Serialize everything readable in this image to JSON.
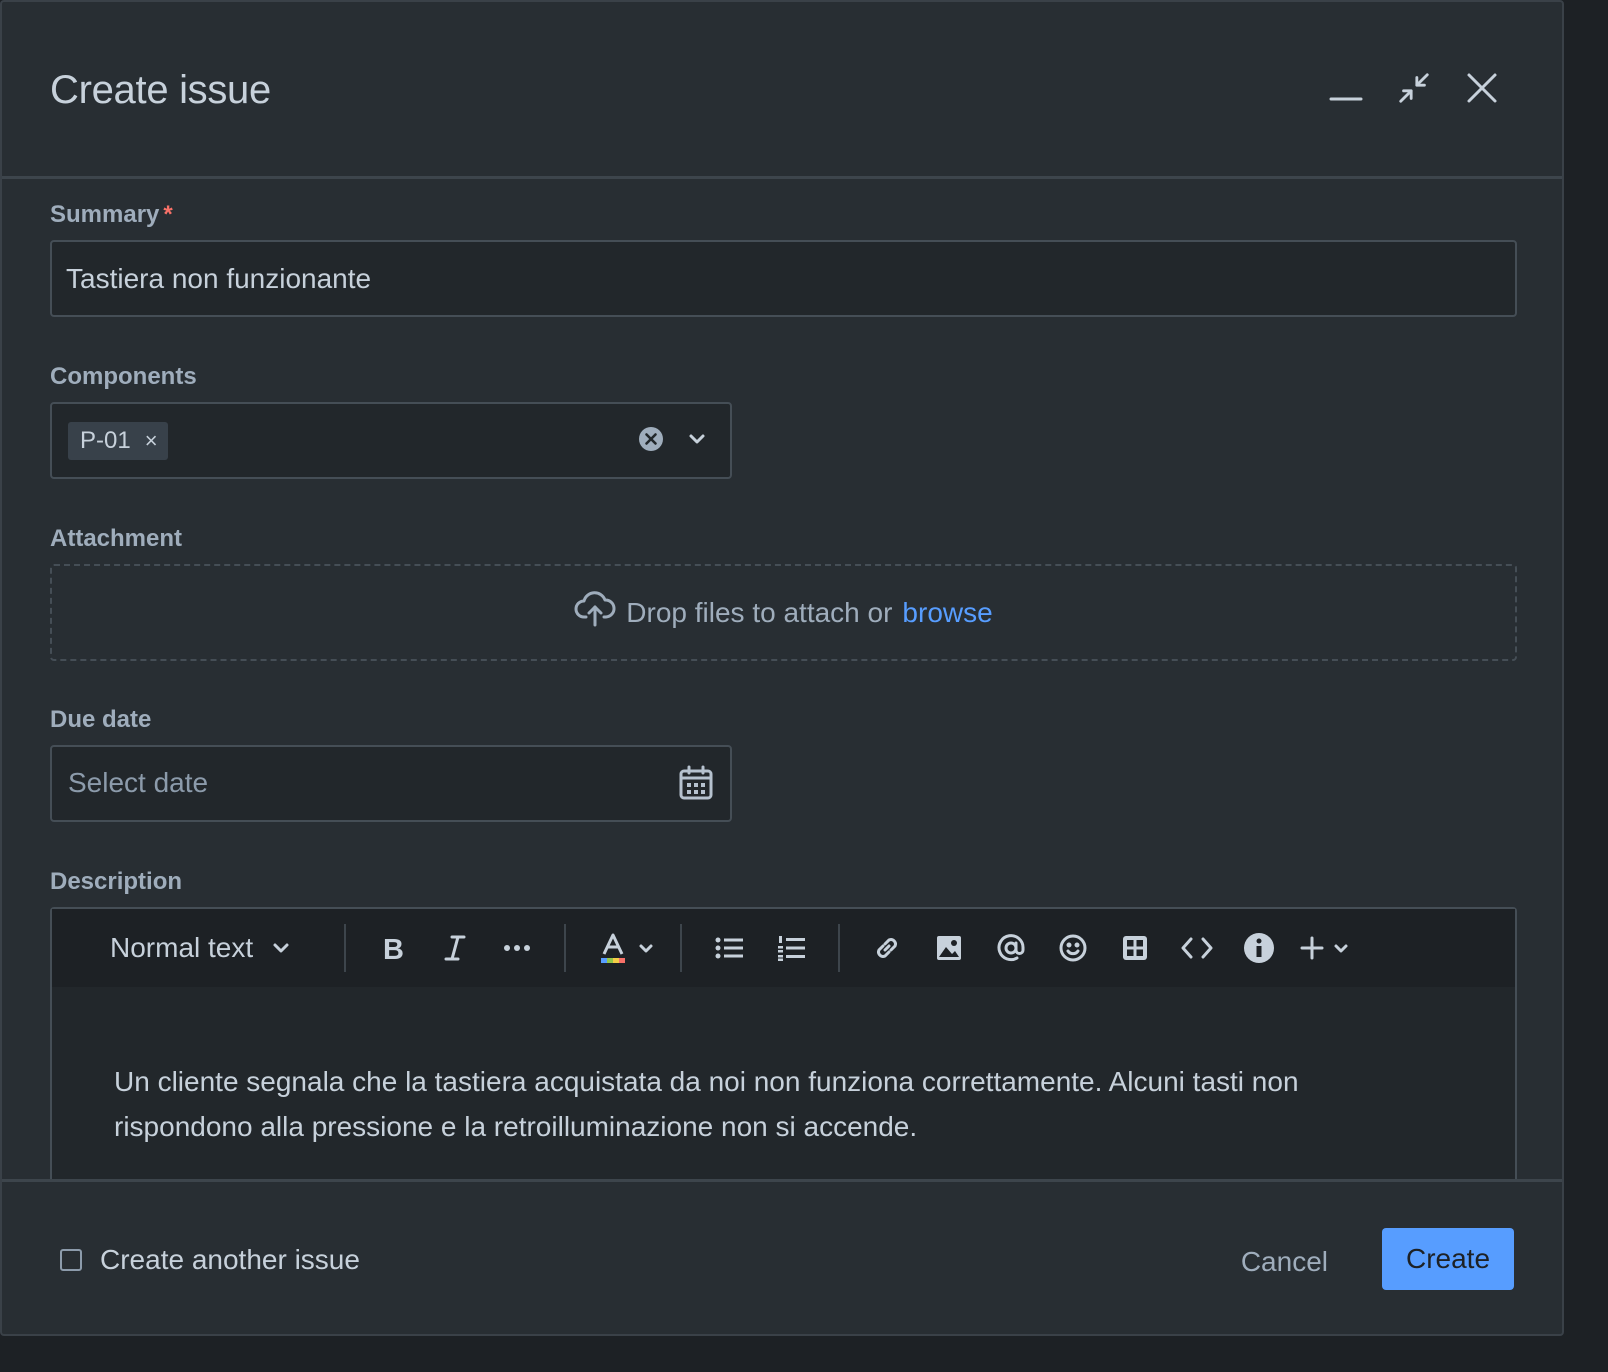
{
  "modal": {
    "title": "Create issue",
    "header_icons": [
      "minimize-icon",
      "collapse-icon",
      "close-icon"
    ]
  },
  "summary": {
    "label": "Summary",
    "required_mark": "*",
    "value": "Tastiera non funzionante"
  },
  "components": {
    "label": "Components",
    "tags": [
      {
        "label": "P-01"
      }
    ],
    "tag_remove": "×"
  },
  "attachment": {
    "label": "Attachment",
    "drop_text": "Drop files to attach or",
    "browse_link": "browse"
  },
  "due_date": {
    "label": "Due date",
    "placeholder": "Select date"
  },
  "description": {
    "label": "Description",
    "toolbar": {
      "text_style": "Normal text",
      "buttons": [
        "bold-icon",
        "italic-icon",
        "more-formatting-icon",
        "text-color-icon",
        "bullet-list-icon",
        "numbered-list-icon",
        "link-icon",
        "image-icon",
        "mention-icon",
        "emoji-icon",
        "table-icon",
        "code-icon",
        "info-panel-icon",
        "insert-plus-icon"
      ]
    },
    "text": "Un cliente segnala che la tastiera acquistata da noi non funziona correttamente. Alcuni tasti non rispondono alla pressione e la retroilluminazione non si accende."
  },
  "footer": {
    "create_another_label": "Create another issue",
    "create_another_checked": false,
    "cancel_label": "Cancel",
    "create_label": "Create"
  },
  "colors": {
    "accent": "#579dff",
    "required": "#f87168",
    "background": "#282e33"
  }
}
